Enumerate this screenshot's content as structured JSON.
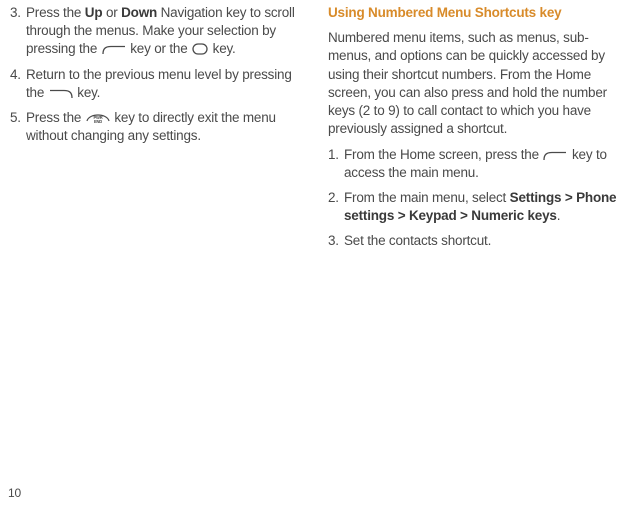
{
  "left": {
    "s3_num": "3.",
    "s3_a": "Press the ",
    "s3_up": "Up",
    "s3_b": " or ",
    "s3_down": "Down",
    "s3_c": " Navigation key to scroll through the menus. Make your selection by pressing the ",
    "s3_d": " key or the ",
    "s3_e": " key.",
    "s4_num": "4.",
    "s4_a": "Return to the previous menu level by pressing the ",
    "s4_b": " key.",
    "s5_num": "5.",
    "s5_a": "Press the ",
    "s5_b": " key to directly exit the menu without changing any settings."
  },
  "right": {
    "heading": "Using Numbered Menu Shortcuts key",
    "intro": "Numbered menu items, such as menus, sub-menus, and options can be quickly accessed by using their shortcut numbers. From the Home screen, you can also press and hold the number keys (2 to 9) to call contact to which you have previously assigned a shortcut.",
    "s1_num": "1.",
    "s1_a": "From the Home screen, press the ",
    "s1_b": " key to access the main menu.",
    "s2_num": "2.",
    "s2_a": "From the main menu, select ",
    "s2_bold": "Settings > Phone settings > Keypad > Numeric keys",
    "s2_b": ".",
    "s3_num": "3.",
    "s3_a": "Set the contacts shortcut."
  },
  "pagenum": "10"
}
